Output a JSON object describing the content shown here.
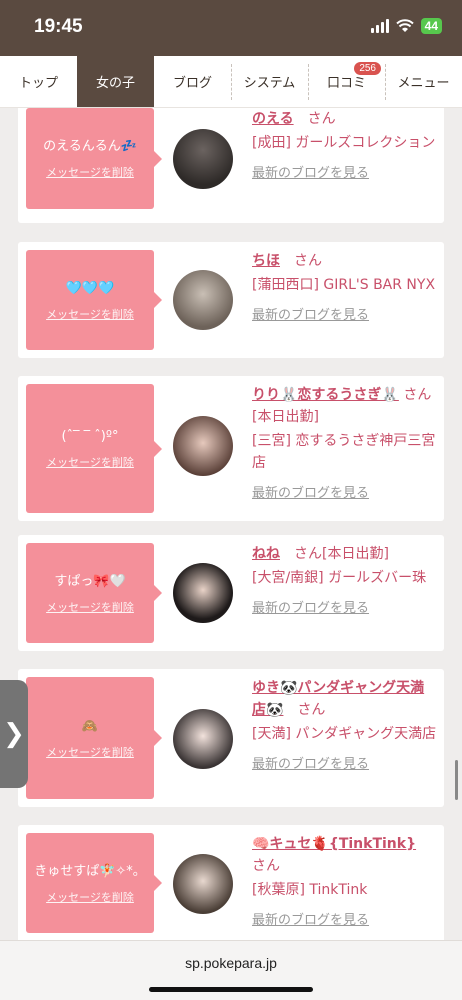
{
  "status": {
    "time": "19:45",
    "battery": "44"
  },
  "nav": {
    "tabs": [
      {
        "label": "トップ"
      },
      {
        "label": "女の子",
        "active": true
      },
      {
        "label": "ブログ"
      },
      {
        "label": "システム"
      },
      {
        "label": "口コミ",
        "badge": "256"
      },
      {
        "label": "メニュー"
      }
    ]
  },
  "cards": [
    {
      "message": "のえるんるん💤",
      "delete_label": "メッセージを削除",
      "name": "のえる",
      "suffix": "さん",
      "shop": "[成田] ガールズコレクション",
      "blog_label": "最新のブログを見る"
    },
    {
      "message": "🩵🩵🩵",
      "delete_label": "メッセージを削除",
      "name": "ちほ",
      "suffix": "さん",
      "shop": "[蒲田西口] GIRL'S BAR NYX",
      "blog_label": "最新のブログを見る"
    },
    {
      "message": "(ˆ‾ ‾ ˆ)º°",
      "delete_label": "メッセージを削除",
      "name": "りり🐰恋するうさぎ🐰",
      "suffix": "さん[本日出勤]",
      "shop": "[三宮] 恋するうさぎ神戸三宮店",
      "blog_label": "最新のブログを見る"
    },
    {
      "message": "すぱっ🎀🤍",
      "delete_label": "メッセージを削除",
      "name": "ねね",
      "suffix": "さん[本日出勤]",
      "shop": "[大宮/南銀] ガールズバー珠",
      "blog_label": "最新のブログを見る"
    },
    {
      "message": "🙈",
      "delete_label": "メッセージを削除",
      "name": "ゆき🐼パンダギャング天満店🐼",
      "suffix": "さん",
      "shop": "[天満] パンダギャング天満店",
      "blog_label": "最新のブログを見る"
    },
    {
      "message": "きゅせすぱ🧚🏻✧*。",
      "delete_label": "メッセージを削除",
      "name": "🧠キュセ🫀{TinkTink}",
      "suffix": "さん",
      "shop": "[秋葉原] TinkTink",
      "blog_label": "最新のブログを見る"
    }
  ],
  "url": "sp.pokepara.jp"
}
